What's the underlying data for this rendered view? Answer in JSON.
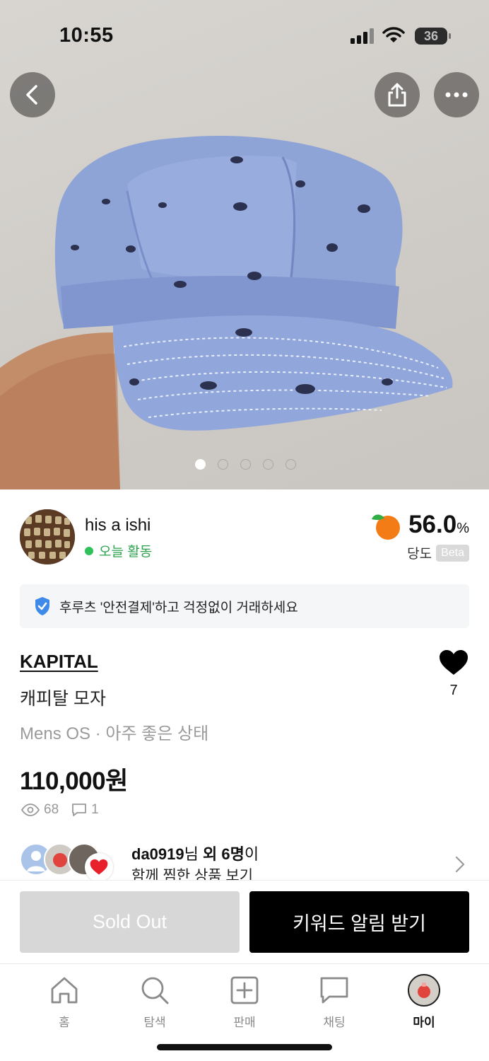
{
  "status_bar": {
    "time": "10:55",
    "battery": "36"
  },
  "hero": {
    "icons": [
      "back-icon",
      "share-icon",
      "more-icon"
    ],
    "page_count": 5,
    "active_page": 1
  },
  "seller": {
    "name": "his a ishi",
    "activity": "오늘 활동",
    "score_value": "56.0",
    "score_unit": "%",
    "score_label": "당도",
    "beta": "Beta"
  },
  "safe_banner": {
    "text": "후루츠 '안전결제'하고 걱정없이 거래하세요"
  },
  "product": {
    "brand": "KAPITAL",
    "title": "캐피탈 모자",
    "meta": "Mens OS · 아주 좋은 상태",
    "price": "110,000원",
    "views": "68",
    "comments": "1",
    "likes": "7"
  },
  "together": {
    "user": "da0919",
    "suffix_a": "님 ",
    "others": "외 6명",
    "suffix_b": "이",
    "line2": "함께 찜한 상품 보기"
  },
  "actions": {
    "sold_out": "Sold Out",
    "keyword_alert": "키워드 알림 받기"
  },
  "tabbar": [
    {
      "label": "홈",
      "icon": "home-icon"
    },
    {
      "label": "탐색",
      "icon": "search-icon"
    },
    {
      "label": "판매",
      "icon": "add-square-icon"
    },
    {
      "label": "채팅",
      "icon": "chat-icon"
    },
    {
      "label": "마이",
      "icon": "profile-avatar-icon"
    }
  ],
  "colors": {
    "accent_green": "#2fc25b",
    "sold_out_bg": "#d7d7d7",
    "primary_black": "#000000"
  }
}
